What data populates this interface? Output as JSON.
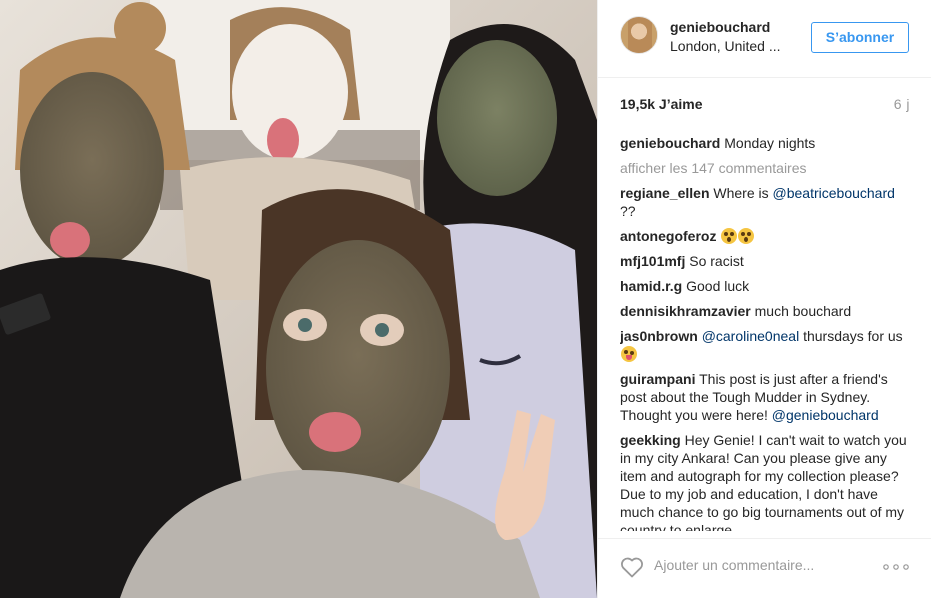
{
  "photo": {
    "alt_icon": "post-photo-image"
  },
  "header": {
    "username": "geniebouchard",
    "location": "London, United ...",
    "follow_label": "S’abonner",
    "avatar_icon": "avatar"
  },
  "stats": {
    "likes": "19,5k J’aime",
    "age": "6 j"
  },
  "caption": {
    "user": "geniebouchard",
    "text": "Monday nights"
  },
  "load_more": "afficher les 147 commentaires",
  "comments": [
    {
      "user": "regiane_ellen",
      "text": "Where is ",
      "mention": "@beatricebouchard",
      "after": "??"
    },
    {
      "user": "antonegoferoz",
      "text": "",
      "emoji": "shocked-face-icon x2"
    },
    {
      "user": "mfj101mfj",
      "text": "So racist"
    },
    {
      "user": "hamid.r.g",
      "text": "Good luck"
    },
    {
      "user": "dennisikhramzavier",
      "text": "much bouchard"
    },
    {
      "user": "jas0nbrown",
      "mention": "@caroline0neal",
      "text": " thursdays for us",
      "emoji": "tongue-face-icon"
    },
    {
      "user": "guirampani",
      "text": "This post is just after a friend's post about the Tough Mudder in Sydney. Thought you were here! ",
      "mention": "@geniebouchard"
    },
    {
      "user": "geekking",
      "text": "Hey Genie! I can't wait to watch you in my city Ankara! Can you please give any item and autograph for my collection please? Due to my job and education, I don't have much chance to go big tournaments out of my country to enlarge"
    }
  ],
  "footer": {
    "comment_placeholder": "Ajouter un commentaire...",
    "heart_icon": "heart-icon",
    "more_icon": "more-options-icon"
  },
  "colors": {
    "accent": "#3897f0",
    "mention": "#003569",
    "muted": "#999999",
    "text": "#262626"
  }
}
